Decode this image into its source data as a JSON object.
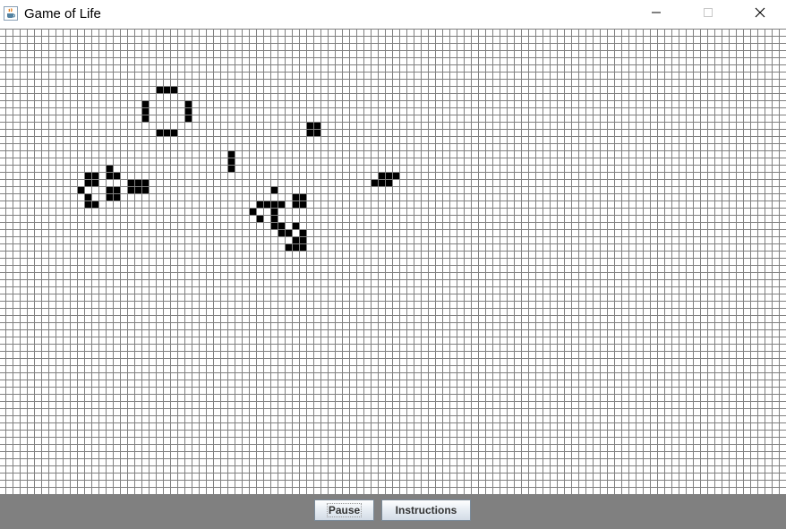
{
  "window": {
    "title": "Game of Life",
    "app_icon": "java-cup-icon",
    "controls": [
      "minimize-icon",
      "maximize-icon",
      "close-icon"
    ]
  },
  "board": {
    "grid_color": "#808080",
    "alive_color": "#000000",
    "dead_color": "#ffffff",
    "alive_cells": [
      [
        8,
        22
      ],
      [
        8,
        23
      ],
      [
        8,
        24
      ],
      [
        10,
        20
      ],
      [
        11,
        20
      ],
      [
        12,
        20
      ],
      [
        10,
        26
      ],
      [
        11,
        26
      ],
      [
        12,
        26
      ],
      [
        14,
        22
      ],
      [
        14,
        23
      ],
      [
        14,
        24
      ],
      [
        13,
        43
      ],
      [
        13,
        44
      ],
      [
        14,
        43
      ],
      [
        14,
        44
      ],
      [
        17,
        32
      ],
      [
        18,
        32
      ],
      [
        19,
        32
      ],
      [
        19,
        15
      ],
      [
        20,
        15
      ],
      [
        20,
        16
      ],
      [
        20,
        12
      ],
      [
        20,
        13
      ],
      [
        21,
        12
      ],
      [
        21,
        13
      ],
      [
        21,
        18
      ],
      [
        21,
        19
      ],
      [
        21,
        20
      ],
      [
        20,
        53
      ],
      [
        20,
        54
      ],
      [
        20,
        55
      ],
      [
        21,
        52
      ],
      [
        21,
        53
      ],
      [
        21,
        54
      ],
      [
        22,
        11
      ],
      [
        22,
        15
      ],
      [
        22,
        16
      ],
      [
        23,
        15
      ],
      [
        23,
        16
      ],
      [
        22,
        18
      ],
      [
        22,
        19
      ],
      [
        22,
        20
      ],
      [
        22,
        38
      ],
      [
        23,
        12
      ],
      [
        24,
        12
      ],
      [
        24,
        13
      ],
      [
        23,
        41
      ],
      [
        23,
        42
      ],
      [
        24,
        41
      ],
      [
        24,
        42
      ],
      [
        24,
        36
      ],
      [
        24,
        37
      ],
      [
        24,
        38
      ],
      [
        24,
        39
      ],
      [
        25,
        35
      ],
      [
        25,
        38
      ],
      [
        26,
        36
      ],
      [
        26,
        38
      ],
      [
        27,
        38
      ],
      [
        27,
        39
      ],
      [
        27,
        41
      ],
      [
        28,
        39
      ],
      [
        28,
        40
      ],
      [
        28,
        42
      ],
      [
        29,
        41
      ],
      [
        29,
        42
      ],
      [
        30,
        40
      ],
      [
        30,
        41
      ],
      [
        30,
        42
      ]
    ]
  },
  "controls": {
    "pause_label": "Pause",
    "instructions_label": "Instructions"
  }
}
